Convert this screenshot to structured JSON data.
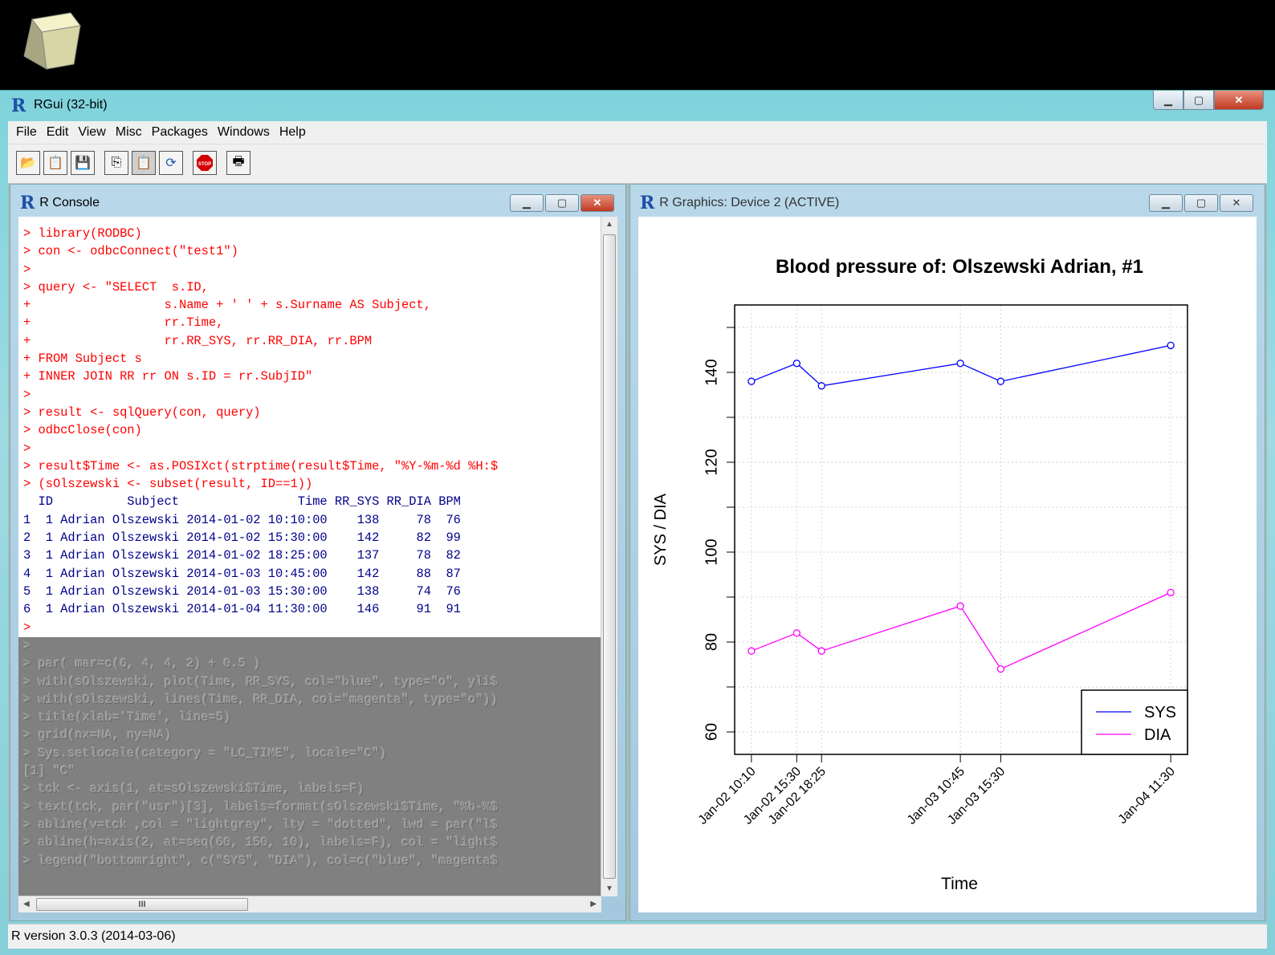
{
  "window": {
    "title": "RGui (32-bit)",
    "logo": "R",
    "caption_buttons": [
      "minimize-icon",
      "maximize-icon",
      "close-icon"
    ]
  },
  "menu": [
    "File",
    "Edit",
    "View",
    "Misc",
    "Packages",
    "Windows",
    "Help"
  ],
  "toolbar": [
    "open-script-icon",
    "load-workspace-icon",
    "save-workspace-icon",
    "copy-icon",
    "paste-icon",
    "copy-paste-icon",
    "stop-icon",
    "print-icon"
  ],
  "console": {
    "title": "R Console",
    "lines_red": [
      "> library(RODBC)",
      "> con <- odbcConnect(\"test1\")",
      ">",
      "> query <- \"SELECT  s.ID,",
      "+                  s.Name + ' ' + s.Surname AS Subject,",
      "+                  rr.Time,",
      "+                  rr.RR_SYS, rr.RR_DIA, rr.BPM",
      "+ FROM Subject s",
      "+ INNER JOIN RR rr ON s.ID = rr.SubjID\"",
      ">",
      "> result <- sqlQuery(con, query)",
      "> odbcClose(con)",
      ">",
      "> result$Time <- as.POSIXct(strptime(result$Time, \"%Y-%m-%d %H:$",
      "> (sOlszewski <- subset(result, ID==1))"
    ],
    "table_header": "  ID          Subject                Time RR_SYS RR_DIA BPM",
    "table_rows": [
      "1  1 Adrian Olszewski 2014-01-02 10:10:00    138     78  76",
      "2  1 Adrian Olszewski 2014-01-02 15:30:00    142     82  99",
      "3  1 Adrian Olszewski 2014-01-02 18:25:00    137     78  82",
      "4  1 Adrian Olszewski 2014-01-03 10:45:00    142     88  87",
      "5  1 Adrian Olszewski 2014-01-03 15:30:00    138     74  76",
      "6  1 Adrian Olszewski 2014-01-04 11:30:00    146     91  91"
    ],
    "prompt_after": ">",
    "lines_gray": [
      ">",
      "> par( mar=c(6, 4, 4, 2) + 0.5 )",
      "> with(sOlszewski, plot(Time, RR_SYS, col=\"blue\", type=\"o\", yli$",
      "> with(sOlszewski, lines(Time, RR_DIA, col=\"magenta\", type=\"o\"))",
      "> title(xlab='Time', line=5)",
      "> grid(nx=NA, ny=NA)",
      "> Sys.setlocale(category = \"LC_TIME\", locale=\"C\")",
      "[1] \"C\"",
      "> tck <- axis(1, at=sOlszewski$Time, labels=F)",
      "> text(tck, par(\"usr\")[3], labels=format(sOlszewski$Time, \"%b-%$",
      "> abline(v=tck ,col = \"lightgray\", lty = \"dotted\", lwd = par(\"l$",
      "> abline(h=axis(2, at=seq(60, 150, 10), labels=F), col = \"light$",
      "> legend(\"bottomright\", c(\"SYS\", \"DIA\"), col=c(\"blue\", \"magenta$"
    ],
    "hscroll_label": "III"
  },
  "graphics": {
    "title": "R Graphics: Device 2 (ACTIVE)"
  },
  "chart_data": {
    "type": "line",
    "title": "Blood pressure of: Olszewski Adrian, #1",
    "xlabel": "Time",
    "ylabel": "SYS / DIA",
    "x": [
      "2014-01-02 10:10",
      "2014-01-02 15:30",
      "2014-01-02 18:25",
      "2014-01-03 10:45",
      "2014-01-03 15:30",
      "2014-01-04 11:30"
    ],
    "tick_labels": [
      "Jan-02 10:10",
      "Jan-02 15:30",
      "Jan-02 18:25",
      "Jan-03 10:45",
      "Jan-03 15:30",
      "Jan-04 11:30"
    ],
    "series": [
      {
        "name": "SYS",
        "color": "#0000ff",
        "values": [
          138,
          142,
          137,
          142,
          138,
          146
        ]
      },
      {
        "name": "DIA",
        "color": "#ff00ff",
        "values": [
          78,
          82,
          78,
          88,
          74,
          91
        ]
      }
    ],
    "ylim": [
      55,
      155
    ],
    "yticks": [
      60,
      70,
      80,
      90,
      100,
      110,
      120,
      130,
      140,
      150
    ],
    "ytick_labels": [
      "60",
      "80",
      "100",
      "120",
      "140"
    ],
    "grid": "dotted lightgray",
    "legend": "bottom-right"
  },
  "status": {
    "text": "R version 3.0.3 (2014-03-06)"
  }
}
